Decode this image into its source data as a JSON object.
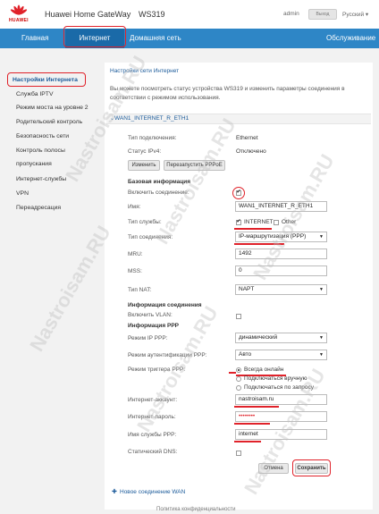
{
  "header": {
    "logo_text": "HUAWEI",
    "brand": "Huawei Home GateWay",
    "model": "WS319",
    "user": "admin",
    "logout": "Выход",
    "language": "Русский ▾"
  },
  "nav": {
    "items": [
      "Главная",
      "Интернет",
      "Домашняя сеть",
      "Обслуживание"
    ],
    "active": "Интернет"
  },
  "sidebar": {
    "items": [
      "Настройки Интернета",
      "Служба IPTV",
      "Режим моста на уровне 2",
      "Родительский контроль",
      "Безопасность сети",
      "Контроль полосы",
      "пропускания",
      "Интернет-службы",
      "VPN",
      "Переадресация"
    ]
  },
  "main": {
    "title": "Настройки сети Интернет",
    "desc": "Вы можете посмотреть статус устройства WS319 и изменить параметры соединения в соответствии с режимом использования.",
    "section": "WAN1_INTERNET_R_ETH1",
    "conn_type_label": "Тип подключения:",
    "conn_type_value": "Ethernet",
    "ipv4_label": "Статус IPv4:",
    "ipv4_value": "Отключено",
    "btn_change": "Изменить",
    "btn_restart": "Перезапустить PPPoE",
    "basic_info": "Базовая информация",
    "enable_label": "Включить соединение:",
    "name_label": "Имя:",
    "name_value": "WAN1_INTERNET_R_ETH1",
    "service_label": "Тип службы:",
    "service_internet": "INTERNET",
    "service_other": "Other",
    "conn_mode_label": "Тип соединения:",
    "conn_mode_value": "IP-маршрутизация (PPP)",
    "mru_label": "MRU:",
    "mru_value": "1492",
    "mss_label": "MSS:",
    "mss_value": "0",
    "nat_label": "Тип NAT:",
    "nat_value": "NAPT",
    "conn_info": "Информация соединения",
    "vlan_label": "Включить VLAN:",
    "ppp_info": "Информация PPP",
    "ip_mode_label": "Режим IP PPP:",
    "ip_mode_value": "динамический",
    "auth_label": "Режим аутентификации PPP:",
    "auth_value": "Авто",
    "trigger_label": "Режим триггера PPP:",
    "trigger_opts": [
      "Всегда онлайн",
      "Подключаться вручную",
      "Подключаться по запросу"
    ],
    "account_label": "Интернет-аккаунт:",
    "account_value": "nastroisam.ru",
    "password_label": "Интернет-пароль:",
    "password_value": "••••••••",
    "service_name_label": "Имя службы PPP:",
    "service_name_value": "internet",
    "static_dns_label": "Статический DNS:",
    "btn_cancel": "Отмена",
    "btn_save": "Сохранить",
    "new_wan": "Новое соединение WAN"
  },
  "footer": {
    "text": "Политика конфиденциальности"
  },
  "watermark": "Nastroisam.RU",
  "colors": {
    "nav_bg": "#2e86c6",
    "highlight": "#e0222a",
    "link": "#1a5a9a"
  }
}
